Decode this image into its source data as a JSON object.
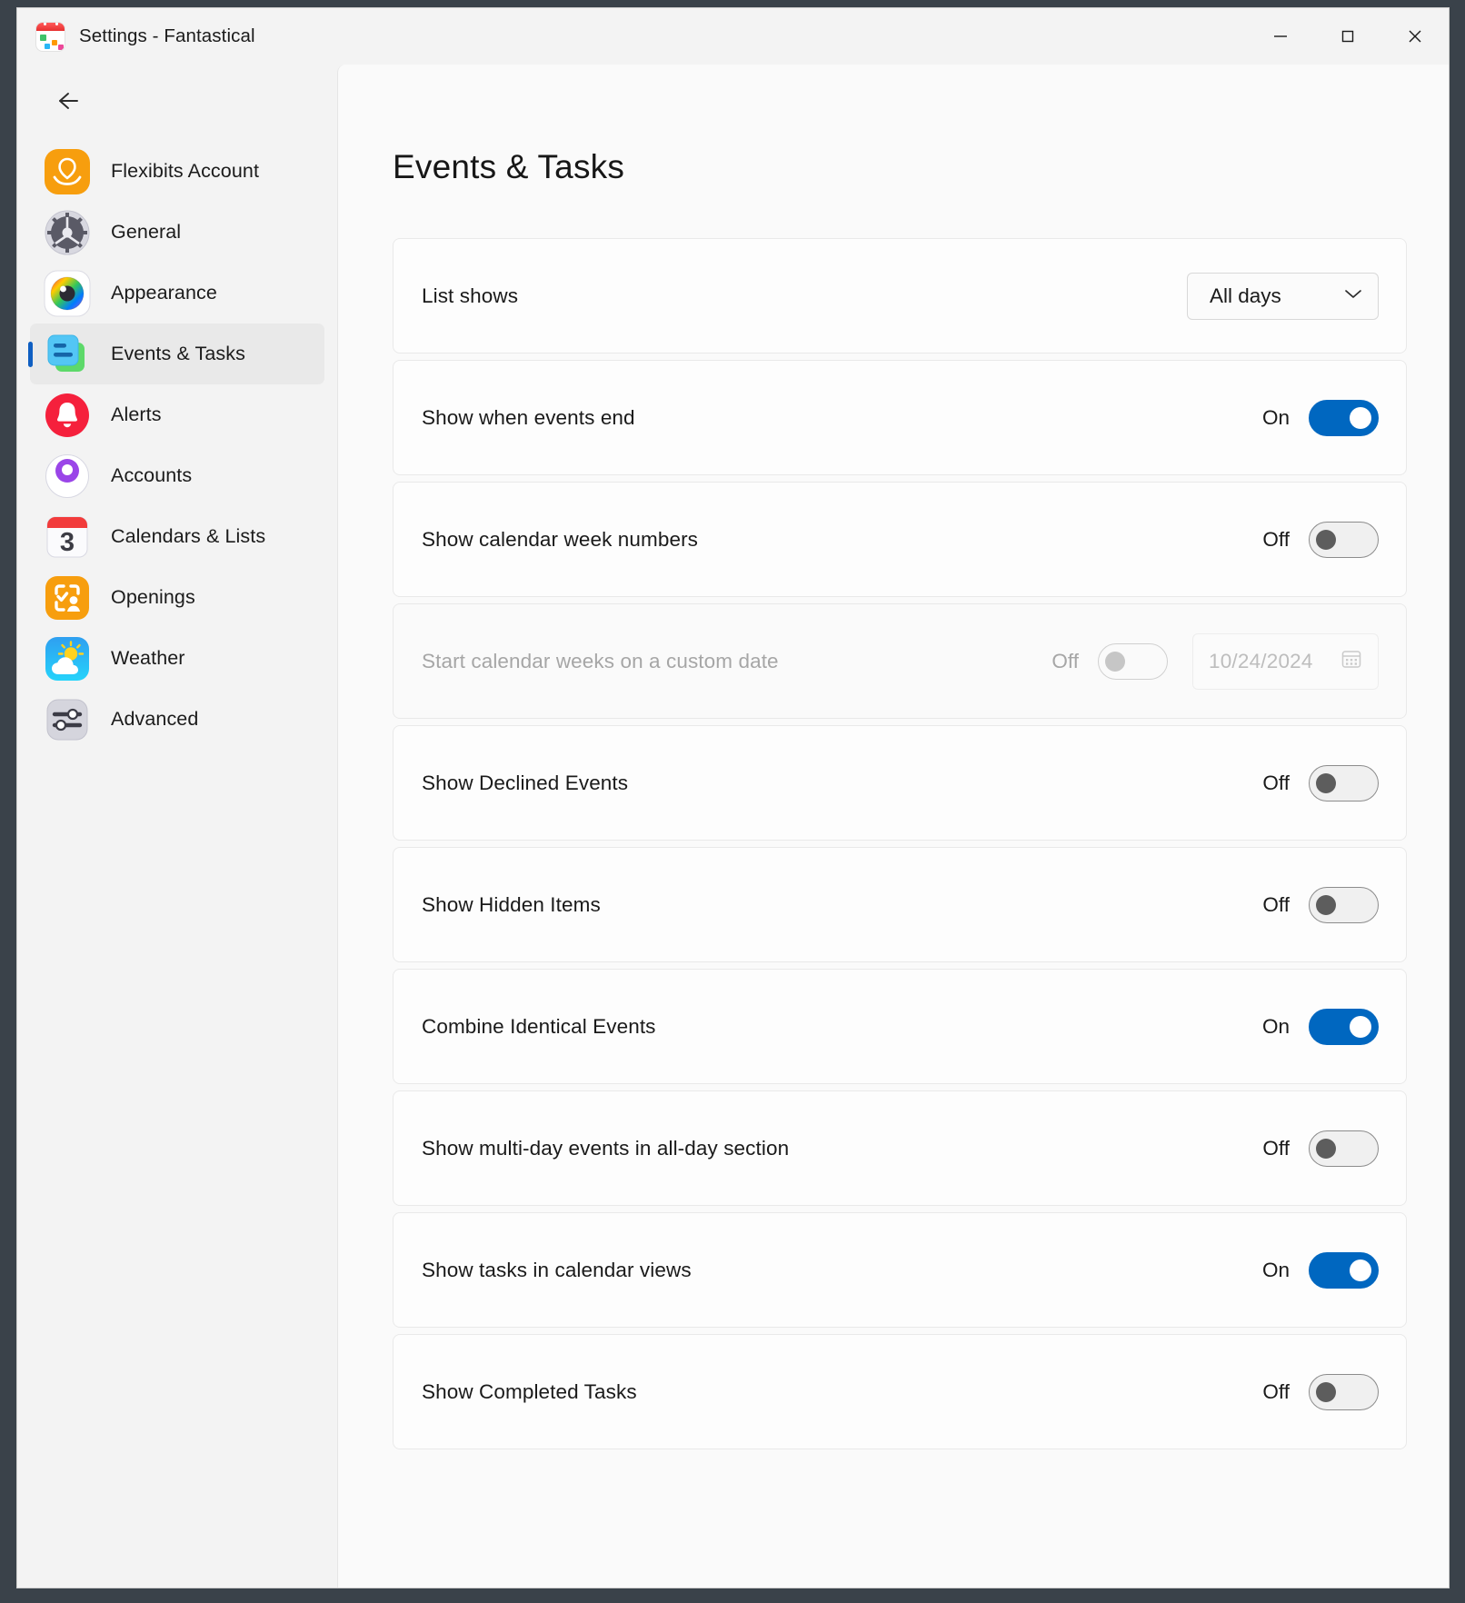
{
  "window": {
    "title": "Settings - Fantastical",
    "app_icon": "fantastical-calendar-icon",
    "controls": {
      "minimize": "minimize-icon",
      "maximize": "maximize-icon",
      "close": "close-icon"
    }
  },
  "sidebar": {
    "back_label": "back-arrow-icon",
    "items": [
      {
        "label": "Flexibits Account",
        "icon": "flexibits-account-icon",
        "active": false
      },
      {
        "label": "General",
        "icon": "gear-icon",
        "active": false
      },
      {
        "label": "Appearance",
        "icon": "color-wheel-icon",
        "active": false
      },
      {
        "label": "Events & Tasks",
        "icon": "events-tasks-icon",
        "active": true
      },
      {
        "label": "Alerts",
        "icon": "bell-icon",
        "active": false
      },
      {
        "label": "Accounts",
        "icon": "person-circle-icon",
        "active": false
      },
      {
        "label": "Calendars & Lists",
        "icon": "calendar-3-icon",
        "active": false
      },
      {
        "label": "Openings",
        "icon": "openings-icon",
        "active": false
      },
      {
        "label": "Weather",
        "icon": "weather-sun-cloud-icon",
        "active": false
      },
      {
        "label": "Advanced",
        "icon": "sliders-icon",
        "active": false
      }
    ]
  },
  "main": {
    "page_title": "Events & Tasks",
    "rows": [
      {
        "label": "List shows",
        "control": "dropdown",
        "value": "All days",
        "options": [
          "All days"
        ],
        "disabled": false
      },
      {
        "label": "Show when events end",
        "control": "toggle",
        "state": "On",
        "disabled": false
      },
      {
        "label": "Show calendar week numbers",
        "control": "toggle",
        "state": "Off",
        "disabled": false
      },
      {
        "label": "Start calendar weeks on a custom date",
        "control": "toggle-date",
        "state": "Off",
        "date_value": "10/24/2024",
        "date_icon": "calendar-picker-icon",
        "disabled": true
      },
      {
        "label": "Show Declined Events",
        "control": "toggle",
        "state": "Off",
        "disabled": false
      },
      {
        "label": "Show Hidden Items",
        "control": "toggle",
        "state": "Off",
        "disabled": false
      },
      {
        "label": "Combine Identical Events",
        "control": "toggle",
        "state": "On",
        "disabled": false
      },
      {
        "label": "Show multi-day events in all-day section",
        "control": "toggle",
        "state": "Off",
        "disabled": false
      },
      {
        "label": "Show tasks in calendar views",
        "control": "toggle",
        "state": "On",
        "disabled": false
      },
      {
        "label": "Show Completed Tasks",
        "control": "toggle",
        "state": "Off",
        "disabled": false
      }
    ]
  },
  "colors": {
    "accent_on": "#0067C0",
    "selection_bar": "#0F5FC2",
    "window_chrome": "#F3F3F3",
    "content_bg": "#FAFAFA",
    "card_bg": "#FDFDFD",
    "desktop": "#3A424A"
  }
}
